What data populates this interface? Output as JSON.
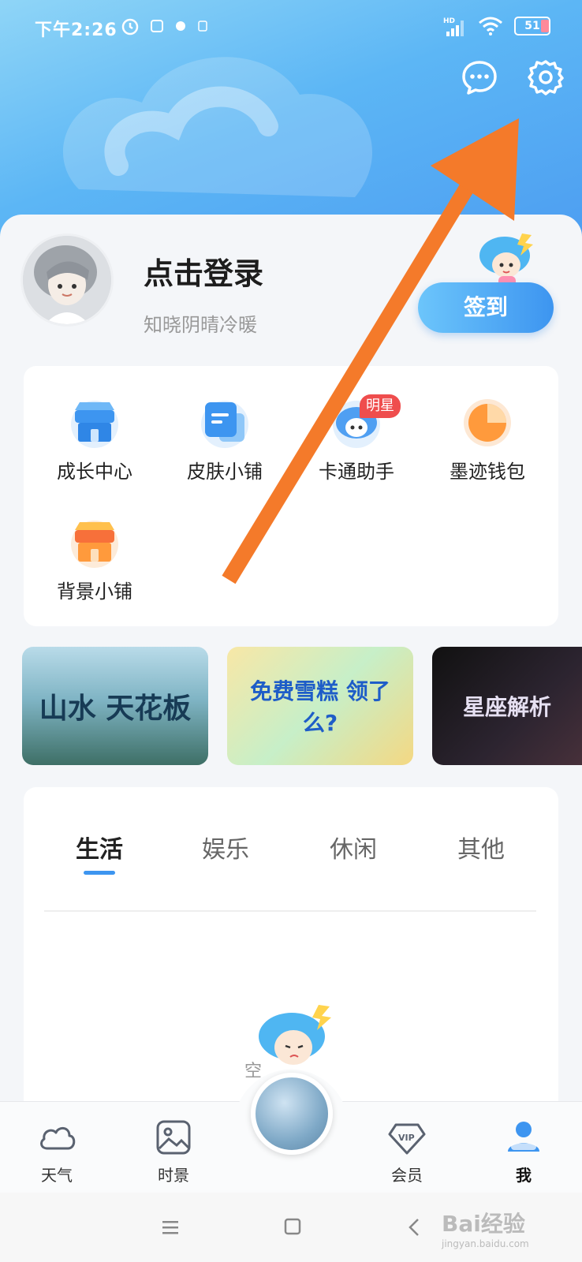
{
  "status_bar": {
    "time": "下午2:26",
    "battery_level": "51"
  },
  "header": {
    "message_icon": "chat-bubble-icon",
    "settings_icon": "gear-icon"
  },
  "profile": {
    "login_title": "点击登录",
    "subtitle": "知晓阴晴冷暖",
    "checkin_label": "签到"
  },
  "tools": [
    {
      "label": "成长中心",
      "icon": "shop-blue-icon"
    },
    {
      "label": "皮肤小铺",
      "icon": "skin-doc-icon"
    },
    {
      "label": "卡通助手",
      "icon": "cartoon-assistant-icon",
      "badge": "明星"
    },
    {
      "label": "墨迹钱包",
      "icon": "wallet-pie-icon"
    },
    {
      "label": "背景小铺",
      "icon": "shop-orange-icon"
    }
  ],
  "banners": [
    {
      "text": "山水 天花板"
    },
    {
      "text": "免费雪糕 领了么?"
    },
    {
      "text": "星座解析"
    }
  ],
  "tabs": [
    {
      "label": "生活",
      "active": true
    },
    {
      "label": "娱乐",
      "active": false
    },
    {
      "label": "休闲",
      "active": false
    },
    {
      "label": "其他",
      "active": false
    }
  ],
  "empty_state": {
    "text": "空"
  },
  "bottom_nav": [
    {
      "label": "天气",
      "icon": "cloud-icon"
    },
    {
      "label": "时景",
      "icon": "picture-icon"
    },
    {
      "label": "会员",
      "icon": "vip-diamond-icon"
    },
    {
      "label": "我",
      "icon": "user-icon",
      "active": true
    }
  ],
  "watermark": {
    "brand": "Bai经验",
    "url": "jingyan.baidu.com"
  },
  "colors": {
    "accent": "#3d95f0",
    "header_gradient_start": "#8fd5f7",
    "header_gradient_end": "#4c9cf1",
    "annotation_arrow": "#f47a2a",
    "badge_red": "#ef4d4d"
  }
}
